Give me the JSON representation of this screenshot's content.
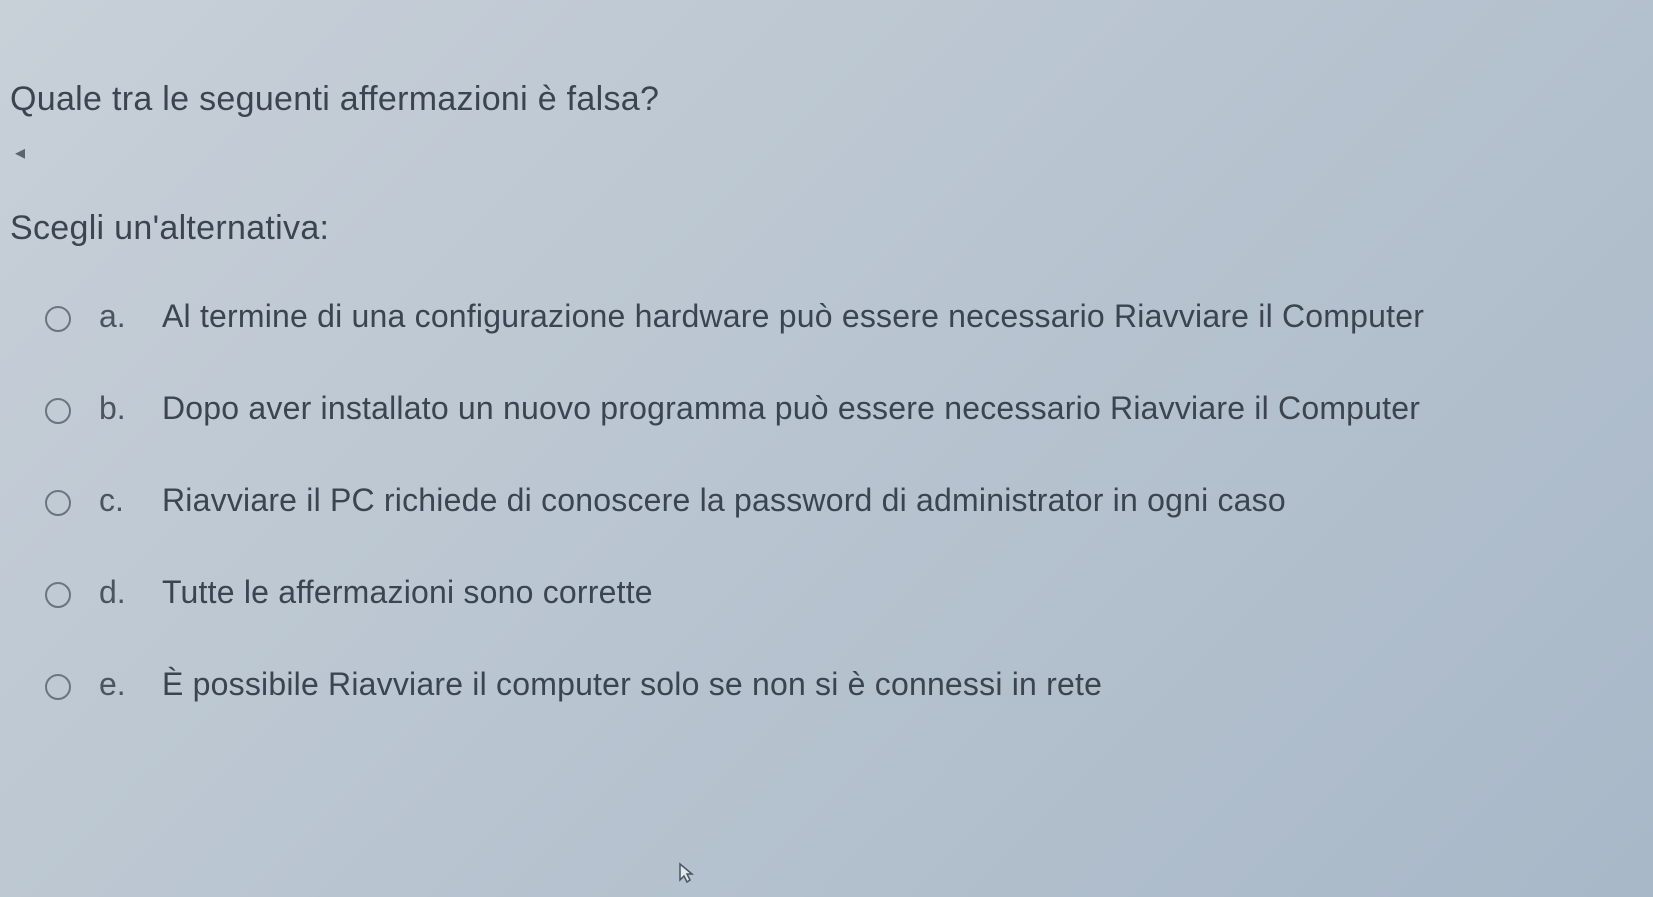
{
  "question": {
    "text": "Quale tra le seguenti affermazioni è falsa?",
    "instruction": "Scegli un'alternativa:",
    "options": [
      {
        "letter": "a.",
        "text": "Al termine di una configurazione hardware può essere necessario Riavviare il Computer"
      },
      {
        "letter": "b.",
        "text": "Dopo aver installato un nuovo programma può essere necessario Riavviare il Computer"
      },
      {
        "letter": "c.",
        "text": "Riavviare il PC richiede di conoscere la password di administrator in ogni caso"
      },
      {
        "letter": "d.",
        "text": "Tutte le affermazioni sono corrette"
      },
      {
        "letter": "e.",
        "text": "È possibile Riavviare il computer solo se non si è connessi in rete"
      }
    ]
  }
}
